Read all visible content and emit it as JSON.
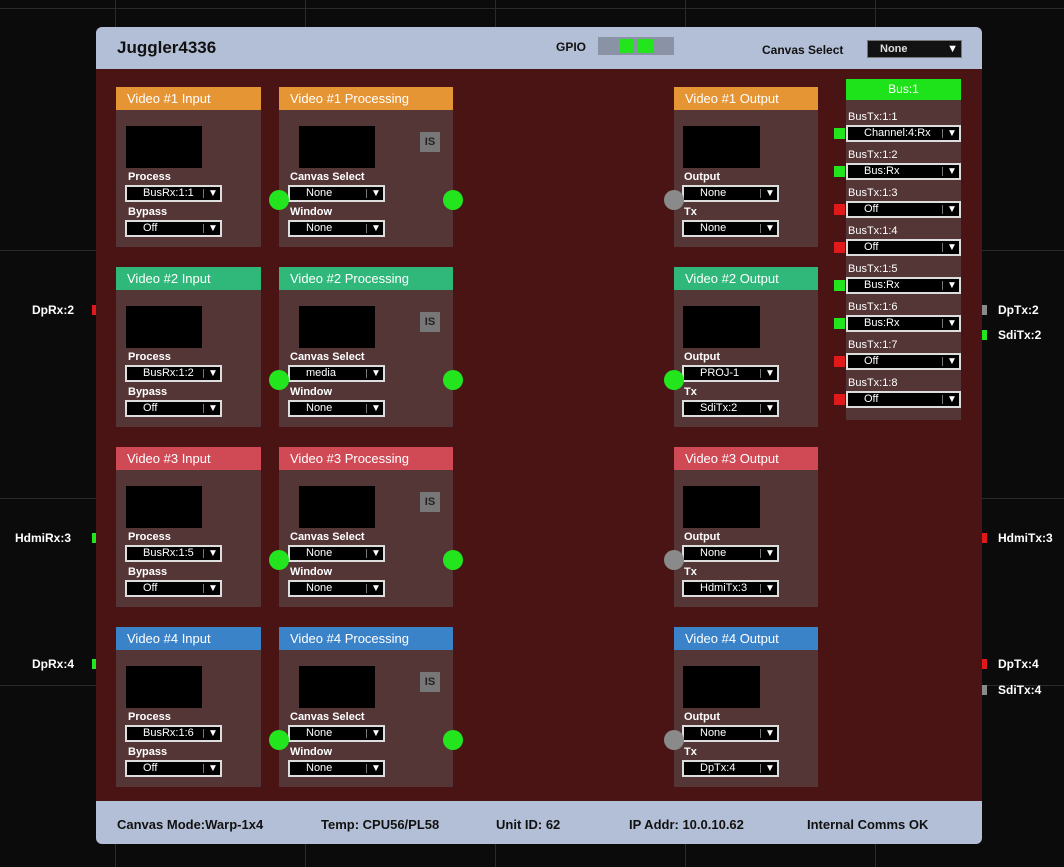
{
  "device": {
    "title": "Juggler4336"
  },
  "gpio": {
    "label": "GPIO",
    "leds": [
      "#8a93a6",
      "#22e51e",
      "#22e51e",
      "#8a93a6"
    ]
  },
  "canvas_select": {
    "label": "Canvas Select",
    "value": "None"
  },
  "videos": [
    {
      "color": "#e69535",
      "input": {
        "title": "Video #1 Input",
        "process_label": "Process",
        "process_value": "BusRx:1:1",
        "bypass_label": "Bypass",
        "bypass_value": "Off"
      },
      "processing": {
        "title": "Video #1 Processing",
        "is_label": "IS",
        "canvas_label": "Canvas Select",
        "canvas_value": "None",
        "window_label": "Window",
        "window_value": "None",
        "in_dot": "green",
        "out_dot": "green"
      },
      "output": {
        "title": "Video #1 Output",
        "output_label": "Output",
        "output_value": "None",
        "tx_label": "Tx",
        "tx_value": "None",
        "dot": "gray"
      }
    },
    {
      "color": "#2fb87a",
      "input": {
        "title": "Video #2 Input",
        "process_label": "Process",
        "process_value": "BusRx:1:2",
        "bypass_label": "Bypass",
        "bypass_value": "Off"
      },
      "processing": {
        "title": "Video #2 Processing",
        "is_label": "IS",
        "canvas_label": "Canvas Select",
        "canvas_value": "media",
        "window_label": "Window",
        "window_value": "None",
        "in_dot": "green",
        "out_dot": "green"
      },
      "output": {
        "title": "Video #2 Output",
        "output_label": "Output",
        "output_value": "PROJ-1",
        "tx_label": "Tx",
        "tx_value": "SdiTx:2",
        "dot": "green"
      }
    },
    {
      "color": "#d04a56",
      "input": {
        "title": "Video #3 Input",
        "process_label": "Process",
        "process_value": "BusRx:1:5",
        "bypass_label": "Bypass",
        "bypass_value": "Off"
      },
      "processing": {
        "title": "Video #3 Processing",
        "is_label": "IS",
        "canvas_label": "Canvas Select",
        "canvas_value": "None",
        "window_label": "Window",
        "window_value": "None",
        "in_dot": "green",
        "out_dot": "green"
      },
      "output": {
        "title": "Video #3 Output",
        "output_label": "Output",
        "output_value": "None",
        "tx_label": "Tx",
        "tx_value": "HdmiTx:3",
        "dot": "gray"
      }
    },
    {
      "color": "#3b83c8",
      "input": {
        "title": "Video #4 Input",
        "process_label": "Process",
        "process_value": "BusRx:1:6",
        "bypass_label": "Bypass",
        "bypass_value": "Off"
      },
      "processing": {
        "title": "Video #4 Processing",
        "is_label": "IS",
        "canvas_label": "Canvas Select",
        "canvas_value": "None",
        "window_label": "Window",
        "window_value": "None",
        "in_dot": "green",
        "out_dot": "green"
      },
      "output": {
        "title": "Video #4 Output",
        "output_label": "Output",
        "output_value": "None",
        "tx_label": "Tx",
        "tx_value": "DpTx:4",
        "dot": "gray"
      }
    }
  ],
  "bus": {
    "title": "Bus:1",
    "channels": [
      {
        "label": "BusTx:1:1",
        "value": "Channel:4:Rx",
        "led": "#22e51e"
      },
      {
        "label": "BusTx:1:2",
        "value": "Bus:Rx",
        "led": "#22e51e"
      },
      {
        "label": "BusTx:1:3",
        "value": "Off",
        "led": "#e01a1a"
      },
      {
        "label": "BusTx:1:4",
        "value": "Off",
        "led": "#e01a1a"
      },
      {
        "label": "BusTx:1:5",
        "value": "Bus:Rx",
        "led": "#22e51e"
      },
      {
        "label": "BusTx:1:6",
        "value": "Bus:Rx",
        "led": "#22e51e"
      },
      {
        "label": "BusTx:1:7",
        "value": "Off",
        "led": "#e01a1a"
      },
      {
        "label": "BusTx:1:8",
        "value": "Off",
        "led": "#e01a1a"
      }
    ]
  },
  "external_inputs": [
    {
      "label": "DpRx:2",
      "led": "#e01a1a"
    },
    {
      "label": "HdmiRx:3",
      "led": "#22e51e"
    },
    {
      "label": "DpRx:4",
      "led": "#22e51e"
    }
  ],
  "external_outputs": [
    {
      "label": "DpTx:2",
      "led": "#8a8a8a"
    },
    {
      "label": "SdiTx:2",
      "led": "#22e51e"
    },
    {
      "label": "HdmiTx:3",
      "led": "#e01a1a"
    },
    {
      "label": "DpTx:4",
      "led": "#e01a1a"
    },
    {
      "label": "SdiTx:4",
      "led": "#8a8a8a"
    }
  ],
  "status": {
    "canvas_mode": "Canvas Mode:Warp-1x4",
    "temp": "Temp: CPU56/PL58",
    "unit_id": "Unit ID: 62",
    "ip_addr": "IP Addr: 10.0.10.62",
    "comms": "Internal Comms OK"
  }
}
